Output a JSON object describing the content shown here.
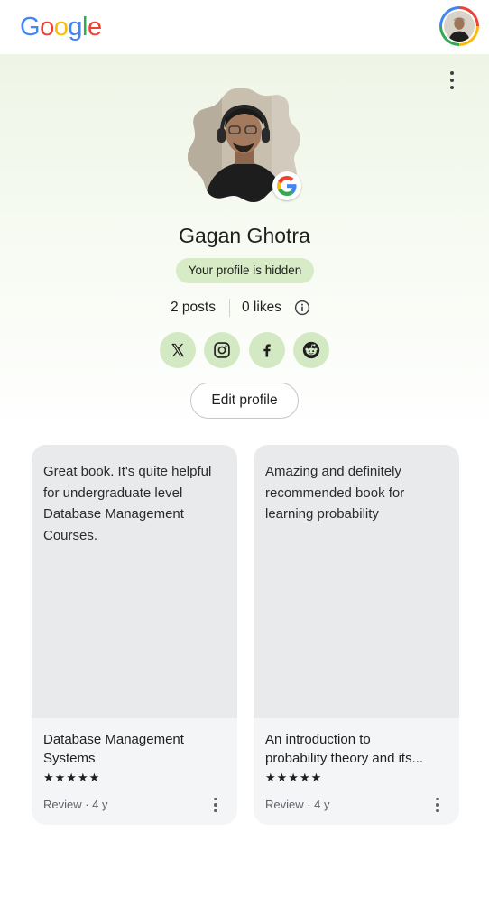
{
  "header": {
    "logo_letters": [
      {
        "char": "G",
        "color": "#4285f4"
      },
      {
        "char": "o",
        "color": "#ea4335"
      },
      {
        "char": "o",
        "color": "#fbbc05"
      },
      {
        "char": "g",
        "color": "#4285f4"
      },
      {
        "char": "l",
        "color": "#34a853"
      },
      {
        "char": "e",
        "color": "#ea4335"
      }
    ]
  },
  "profile": {
    "name": "Gagan Ghotra",
    "visibility_chip": "Your profile is hidden",
    "posts": "2 posts",
    "likes": "0 likes"
  },
  "socials": [
    {
      "icon": "x-icon"
    },
    {
      "icon": "instagram-icon"
    },
    {
      "icon": "facebook-icon"
    },
    {
      "icon": "reddit-icon"
    }
  ],
  "edit_profile_label": "Edit profile",
  "colors": {
    "accent_chip": "#d6ebc6",
    "social_bg": "#d3e9c4",
    "card_bg": "#f4f5f7",
    "card_review_bg": "#e9eaec"
  },
  "cards": [
    {
      "review": "Great book. It's quite helpful for undergraduate level Database Management Courses.",
      "title_line1": "Database Management",
      "title_line2": "Systems",
      "stars": "★★★★★",
      "rating": 5,
      "meta": "Review · 4 y"
    },
    {
      "review": "Amazing and definitely recommended book for learning probability",
      "title_line1": "An introduction to",
      "title_line2": "probability theory and its...",
      "stars": "★★★★★",
      "rating": 5,
      "meta": "Review · 4 y"
    }
  ]
}
